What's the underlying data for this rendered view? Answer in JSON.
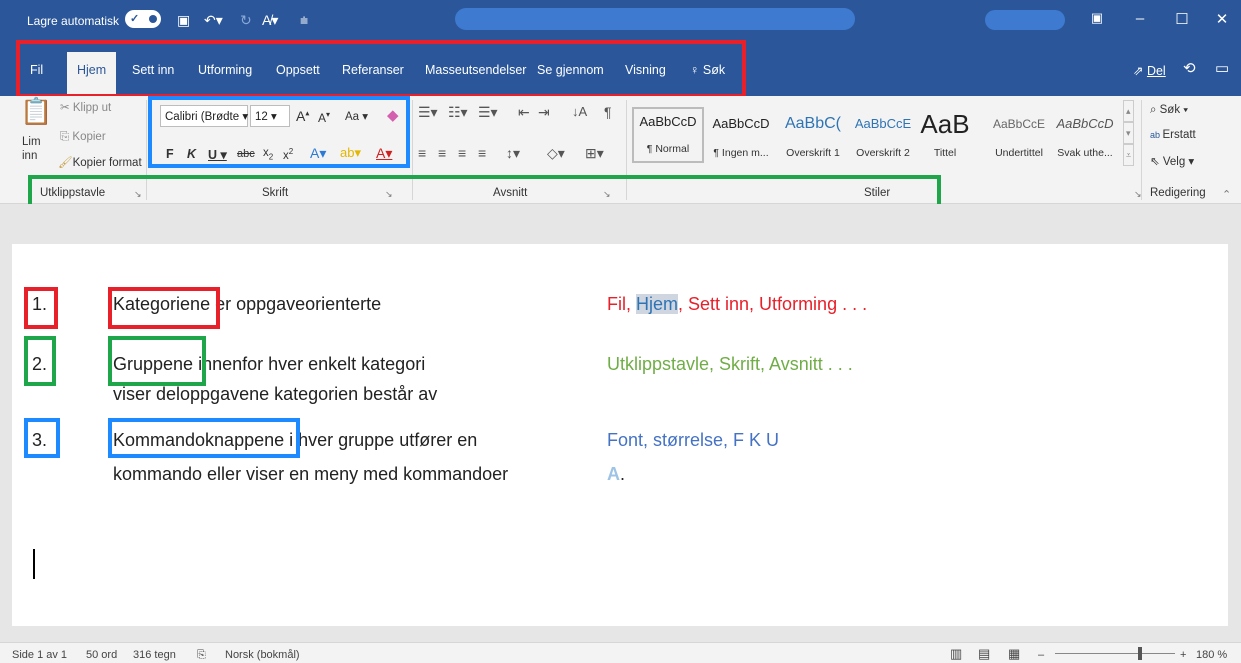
{
  "titlebar": {
    "autosave": "Lagre automatisk",
    "toggle": "✓"
  },
  "tabs": [
    "Fil",
    "Hjem",
    "Sett inn",
    "Utforming",
    "Oppsett",
    "Referanser",
    "Masseutsendelser",
    "Se gjennom",
    "Visning",
    "Søk"
  ],
  "share": "Del",
  "clipboard": {
    "paste": "Lim",
    "paste2": "inn",
    "cut": "Klipp ut",
    "copy": "Kopier",
    "format": "Kopier format"
  },
  "font": {
    "name": "Calibri (Brødte",
    "size": "12",
    "case": "Aa",
    "bold": "F",
    "italic": "K",
    "underline": "U",
    "strike": "abc",
    "sub": "x",
    "sup": "x"
  },
  "styles": [
    {
      "sample": "AaBbCcD",
      "name": "¶ Normal"
    },
    {
      "sample": "AaBbCcD",
      "name": "¶ Ingen m..."
    },
    {
      "sample": "AaBbC(",
      "name": "Overskrift 1"
    },
    {
      "sample": "AaBbCcE",
      "name": "Overskrift 2"
    },
    {
      "sample": "AaB",
      "name": "Tittel"
    },
    {
      "sample": "AaBbCcE",
      "name": "Undertittel"
    },
    {
      "sample": "AaBbCcD",
      "name": "Svak uthe..."
    }
  ],
  "editing": {
    "find": "Søk",
    "replace": "Erstatt",
    "select": "Velg"
  },
  "groups": [
    "Utklippstavle",
    "Skrift",
    "Avsnitt",
    "Stiler",
    "Redigering"
  ],
  "doc": {
    "items": [
      {
        "num": "1.",
        "key": "Kategoriene",
        "rest": " er oppgaveorienterte",
        "line2": "",
        "note": "Fil, Hjem, Sett inn, Utforming . . ."
      },
      {
        "num": "2.",
        "key": "Gruppene",
        "rest": " innenfor hver enkelt kategori",
        "line2": "viser deloppgavene kategorien består av",
        "note": "Utklippstavle, Skrift, Avsnitt . . ."
      },
      {
        "num": "3.",
        "key": "Kommandoknappene",
        "rest": " i hver gruppe utfører en",
        "line2": "kommando eller viser en meny med kommandoer",
        "note": "Font, størrelse, F  K  U"
      }
    ],
    "note1_a": "Fil, ",
    "note1_b": "Hjem",
    "note1_c": ", Sett inn, Utforming . . .",
    "note3_line2": "."
  },
  "status": {
    "page": "Side 1 av 1",
    "words": "50 ord",
    "chars": "316 tegn",
    "lang": "Norsk (bokmål)",
    "zoom": "180 %"
  },
  "colors": {
    "accent": "#2b579a",
    "red": "#e8202a",
    "green": "#1fa64a",
    "blue": "#1e8aff"
  }
}
